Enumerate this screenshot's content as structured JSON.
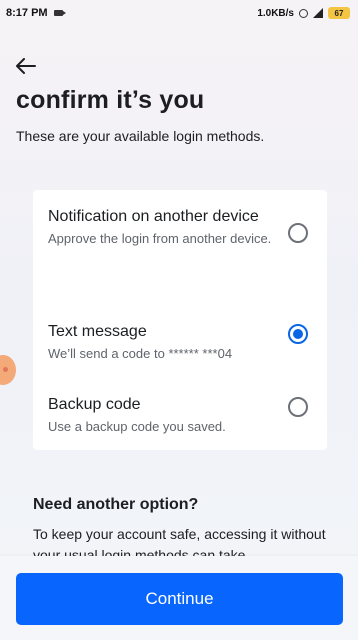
{
  "status_bar": {
    "time": "8:17 PM",
    "net_speed": "1.0KB/s",
    "battery": "67"
  },
  "header": {
    "title": "confirm it’s you",
    "subtitle": "These are your available login methods."
  },
  "options": [
    {
      "title": "Notification on another device",
      "description": "Approve the login from another device.",
      "selected": false
    },
    {
      "title": "Text message",
      "description": "We’ll send a code to ****** ***04",
      "selected": true
    },
    {
      "title": "Backup code",
      "description": "Use a backup code you saved.",
      "selected": false
    }
  ],
  "need_option": {
    "heading": "Need another option?",
    "text": "To keep your account safe, accessing it without your usual login methods can take"
  },
  "continue_label": "Continue",
  "colors": {
    "accent": "#0866ff",
    "radio_selected": "#0a66e4"
  }
}
